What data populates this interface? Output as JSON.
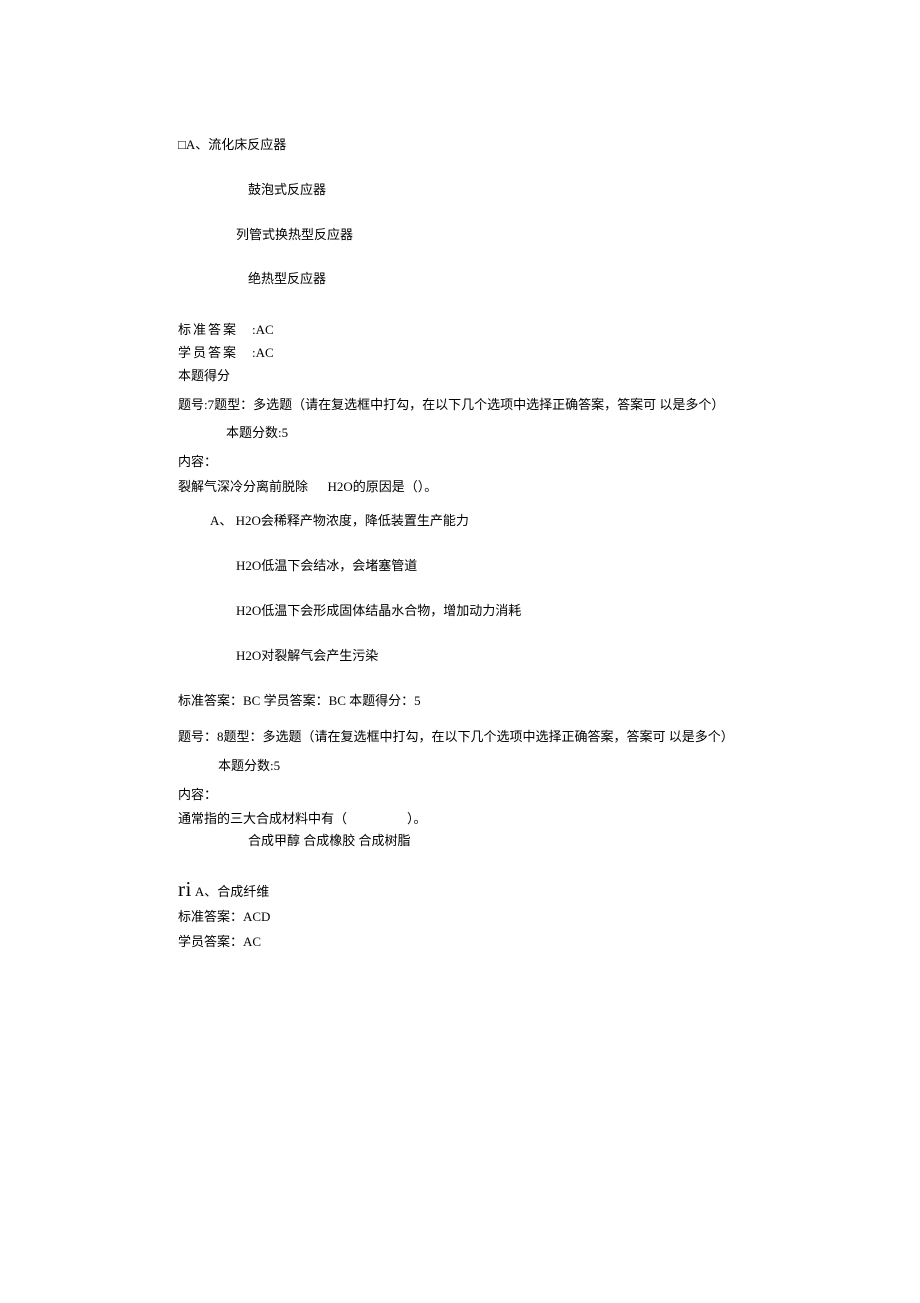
{
  "q6": {
    "options": {
      "A_label": "□A、",
      "A_text": "流化床反应器",
      "B_text": "鼓泡式反应器",
      "C_text": "列管式换热型反应器",
      "D_text": "绝热型反应器"
    },
    "std_label": "标准答案",
    "std_ans": ":AC",
    "stu_label": "学员答案",
    "stu_ans": ":AC",
    "score_label": "本题得分"
  },
  "q7": {
    "header": "题号:7题型：多选题（请在复选框中打勾，在以下几个选项中选择正确答案，答案可 以是多个）",
    "points_label": "本题分数:5",
    "content_label": "内容：",
    "stem_part1": "裂解气深冷分离前脱除",
    "stem_part2": "H2O的原因是（）。",
    "options": {
      "A": "A、 H2O会稀释产物浓度，降低装置生产能力",
      "B": "H2O低温下会结冰，会堵塞管道",
      "C": "H2O低温下会形成固体结晶水合物，增加动力消耗",
      "D": "H2O对裂解气会产生污染"
    },
    "result": "标准答案：BC 学员答案：BC 本题得分：5"
  },
  "q8": {
    "header": "题号：8题型：多选题（请在复选框中打勾，在以下几个选项中选择正确答案，答案可 以是多个）",
    "points_label": "本题分数:5",
    "content_label": "内容：",
    "stem": "通常指的三大合成材料中有（",
    "stem_tail": "）。",
    "sub": "合成甲醇 合成橡胶 合成树脂",
    "ri": "ri",
    "optA": "A、合成纤维",
    "std": "标准答案：ACD",
    "stu": "学员答案：AC"
  }
}
